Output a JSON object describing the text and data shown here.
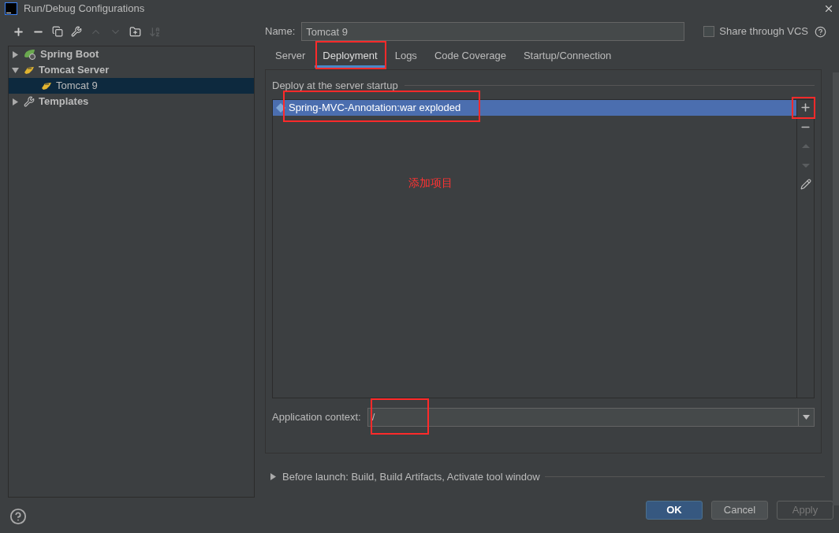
{
  "window": {
    "title": "Run/Debug Configurations"
  },
  "tree": [
    {
      "label": "Spring Boot",
      "kind": "spring",
      "expanded": false,
      "selected": false
    },
    {
      "label": "Tomcat Server",
      "kind": "tomcat",
      "expanded": true,
      "selected": false,
      "children": [
        {
          "label": "Tomcat 9",
          "kind": "tomcat",
          "selected": true
        }
      ]
    },
    {
      "label": "Templates",
      "kind": "wrench",
      "expanded": false,
      "selected": false
    }
  ],
  "name_field": {
    "label": "Name:",
    "value": "Tomcat 9"
  },
  "share": {
    "label": "Share through VCS",
    "checked": false
  },
  "tabs": [
    {
      "label": "Server",
      "selected": false
    },
    {
      "label": "Deployment",
      "selected": true
    },
    {
      "label": "Logs",
      "selected": false
    },
    {
      "label": "Code Coverage",
      "selected": false
    },
    {
      "label": "Startup/Connection",
      "selected": false
    }
  ],
  "deploy": {
    "title": "Deploy at the server startup",
    "items": [
      {
        "label": "Spring-MVC-Annotation:war exploded",
        "selected": true
      }
    ],
    "annotation": "添加项目"
  },
  "context": {
    "label": "Application context:",
    "value": "/"
  },
  "before_launch": {
    "label": "Before launch: Build, Build Artifacts, Activate tool window",
    "expanded": false
  },
  "buttons": [
    {
      "label": "OK",
      "kind": "primary"
    },
    {
      "label": "Cancel",
      "kind": "normal"
    },
    {
      "label": "Apply",
      "kind": "disabled"
    }
  ]
}
